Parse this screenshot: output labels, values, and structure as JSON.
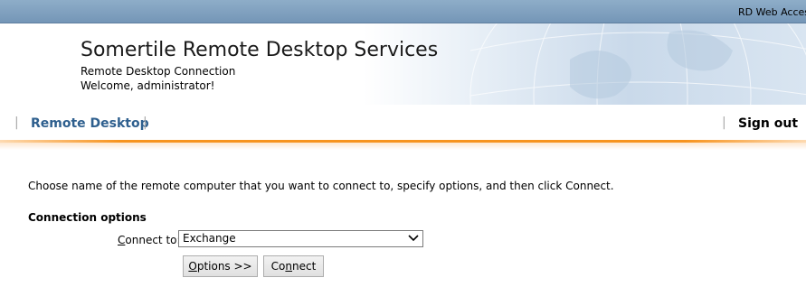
{
  "topbar": {
    "brand": "RD Web Access"
  },
  "banner": {
    "title": "Somertile Remote Desktop Services",
    "subtitle": "Remote Desktop Connection",
    "welcome": "Welcome, administrator!"
  },
  "nav": {
    "remote_desktop": "Remote Desktop",
    "sign_out": "Sign out",
    "separator": "|"
  },
  "content": {
    "instructions": "Choose name of the remote computer that you want to connect to, specify options, and then click Connect.",
    "options_heading": "Connection options",
    "connect_to_label_accel": "C",
    "connect_to_label_rest": "onnect to:",
    "connect_to_value": "Exchange",
    "options_button_accel": "O",
    "options_button_rest": "ptions >>",
    "connect_button_pre": "Co",
    "connect_button_accel": "n",
    "connect_button_rest": "nect"
  },
  "colors": {
    "topbar": "#7e9fbf",
    "nav_link": "#2e5f8e",
    "accent_line": "#f7931e"
  }
}
